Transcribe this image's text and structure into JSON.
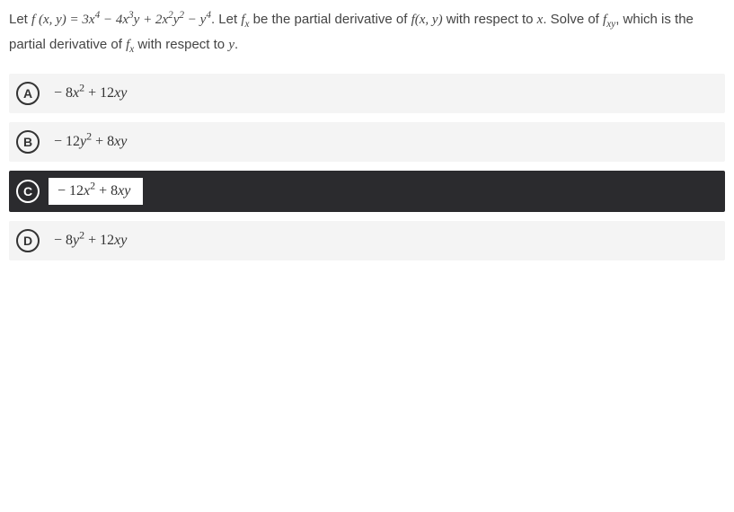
{
  "question": {
    "prefix1": "Let ",
    "func_def": "f (x, y) = 3x⁴ − 4x³y + 2x²y² − y⁴",
    "dot_let": ". Let ",
    "fx": "f",
    "fx_sub": "x",
    "mid1": " be the partial derivative of ",
    "fxy_plain": "f(x, y)",
    "mid2": " with respect to ",
    "var_x": "x",
    "mid3": ". Solve of ",
    "fxy": "f",
    "fxy_sub": "xy",
    "mid4": ", which is the partial derivative of ",
    "fx2": "f",
    "fx2_sub": "x",
    "mid5": " with respect to ",
    "var_y": "y",
    "end": "."
  },
  "options": [
    {
      "letter": "A",
      "text": "− 8x² + 12xy",
      "selected": false
    },
    {
      "letter": "B",
      "text": "− 12y² + 8xy",
      "selected": false
    },
    {
      "letter": "C",
      "text": "− 12x² + 8xy",
      "selected": true
    },
    {
      "letter": "D",
      "text": "− 8y² + 12xy",
      "selected": false
    }
  ]
}
